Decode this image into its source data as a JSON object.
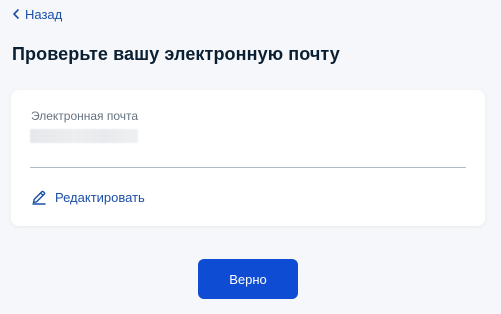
{
  "nav": {
    "back_label": "Назад"
  },
  "page": {
    "title": "Проверьте вашу электронную почту"
  },
  "email_card": {
    "field_label": "Электронная почта",
    "edit_label": "Редактировать"
  },
  "actions": {
    "confirm_label": "Верно"
  },
  "icons": {
    "back": "chevron-left-icon",
    "edit": "pencil-icon"
  },
  "colors": {
    "accent": "#0d4cd3",
    "link": "#1b4fa8",
    "title": "#0b1f33",
    "label": "#66727f",
    "background": "#f5f7fa",
    "card": "#ffffff"
  }
}
